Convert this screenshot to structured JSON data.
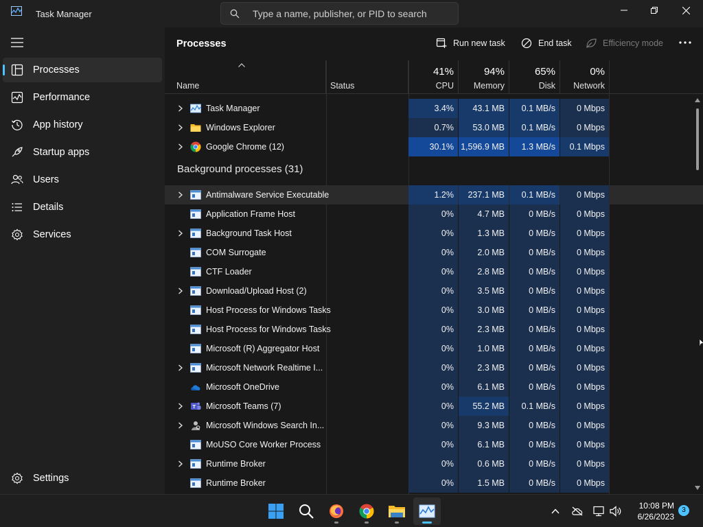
{
  "window": {
    "title": "Task Manager",
    "search_placeholder": "Type a name, publisher, or PID to search"
  },
  "sidebar": {
    "items": [
      {
        "label": "Processes",
        "icon": "processes-icon",
        "active": true
      },
      {
        "label": "Performance",
        "icon": "performance-icon"
      },
      {
        "label": "App history",
        "icon": "history-icon"
      },
      {
        "label": "Startup apps",
        "icon": "startup-icon"
      },
      {
        "label": "Users",
        "icon": "users-icon"
      },
      {
        "label": "Details",
        "icon": "details-icon"
      },
      {
        "label": "Services",
        "icon": "services-icon"
      }
    ],
    "settings_label": "Settings"
  },
  "toolbar": {
    "title": "Processes",
    "run_new_task": "Run new task",
    "end_task": "End task",
    "efficiency_mode": "Efficiency mode"
  },
  "columns": {
    "name": "Name",
    "status": "Status",
    "cpu": {
      "pct": "41%",
      "label": "CPU"
    },
    "memory": {
      "pct": "94%",
      "label": "Memory"
    },
    "disk": {
      "pct": "65%",
      "label": "Disk"
    },
    "network": {
      "pct": "0%",
      "label": "Network"
    }
  },
  "apps": [
    {
      "name": "Task Manager",
      "expandable": true,
      "icon": "taskmanager-icon",
      "cpu": "3.4%",
      "memory": "43.1 MB",
      "disk": "0.1 MB/s",
      "network": "0 Mbps",
      "heat": {
        "cpu": 2,
        "memory": 2,
        "disk": 2,
        "network": 1
      }
    },
    {
      "name": "Windows Explorer",
      "expandable": true,
      "icon": "folder-icon",
      "cpu": "0.7%",
      "memory": "53.0 MB",
      "disk": "0.1 MB/s",
      "network": "0 Mbps",
      "heat": {
        "cpu": 1,
        "memory": 2,
        "disk": 2,
        "network": 1
      }
    },
    {
      "name": "Google Chrome (12)",
      "expandable": true,
      "icon": "chrome-icon",
      "cpu": "30.1%",
      "memory": "1,596.9 MB",
      "disk": "1.3 MB/s",
      "network": "0.1 Mbps",
      "heat": {
        "cpu": 3,
        "memory": 3,
        "disk": 3,
        "network": 2
      }
    }
  ],
  "background": {
    "label": "Background processes (31)",
    "rows": [
      {
        "name": "Antimalware Service Executable",
        "expandable": true,
        "icon": "service-icon",
        "cpu": "1.2%",
        "memory": "237.1 MB",
        "disk": "0.1 MB/s",
        "network": "0 Mbps",
        "heat": {
          "cpu": 2,
          "memory": 2,
          "disk": 2,
          "network": 1
        },
        "hover": true
      },
      {
        "name": "Application Frame Host",
        "expandable": false,
        "icon": "service-icon",
        "cpu": "0%",
        "memory": "4.7 MB",
        "disk": "0 MB/s",
        "network": "0 Mbps",
        "heat": {
          "cpu": 1,
          "memory": 1,
          "disk": 1,
          "network": 1
        }
      },
      {
        "name": "Background Task Host",
        "expandable": true,
        "icon": "service-icon",
        "cpu": "0%",
        "memory": "1.3 MB",
        "disk": "0 MB/s",
        "network": "0 Mbps",
        "heat": {
          "cpu": 1,
          "memory": 1,
          "disk": 1,
          "network": 1
        }
      },
      {
        "name": "COM Surrogate",
        "expandable": false,
        "icon": "service-icon",
        "cpu": "0%",
        "memory": "2.0 MB",
        "disk": "0 MB/s",
        "network": "0 Mbps",
        "heat": {
          "cpu": 1,
          "memory": 1,
          "disk": 1,
          "network": 1
        }
      },
      {
        "name": "CTF Loader",
        "expandable": false,
        "icon": "service-icon",
        "cpu": "0%",
        "memory": "2.8 MB",
        "disk": "0 MB/s",
        "network": "0 Mbps",
        "heat": {
          "cpu": 1,
          "memory": 1,
          "disk": 1,
          "network": 1
        }
      },
      {
        "name": "Download/Upload Host (2)",
        "expandable": true,
        "icon": "service-icon",
        "cpu": "0%",
        "memory": "3.5 MB",
        "disk": "0 MB/s",
        "network": "0 Mbps",
        "heat": {
          "cpu": 1,
          "memory": 1,
          "disk": 1,
          "network": 1
        }
      },
      {
        "name": "Host Process for Windows Tasks",
        "expandable": false,
        "icon": "service-icon",
        "cpu": "0%",
        "memory": "3.0 MB",
        "disk": "0 MB/s",
        "network": "0 Mbps",
        "heat": {
          "cpu": 1,
          "memory": 1,
          "disk": 1,
          "network": 1
        }
      },
      {
        "name": "Host Process for Windows Tasks",
        "expandable": false,
        "icon": "service-icon",
        "cpu": "0%",
        "memory": "2.3 MB",
        "disk": "0 MB/s",
        "network": "0 Mbps",
        "heat": {
          "cpu": 1,
          "memory": 1,
          "disk": 1,
          "network": 1
        }
      },
      {
        "name": "Microsoft (R) Aggregator Host",
        "expandable": false,
        "icon": "service-icon",
        "cpu": "0%",
        "memory": "1.0 MB",
        "disk": "0 MB/s",
        "network": "0 Mbps",
        "heat": {
          "cpu": 1,
          "memory": 1,
          "disk": 1,
          "network": 1
        }
      },
      {
        "name": "Microsoft Network Realtime I...",
        "expandable": true,
        "icon": "service-icon",
        "cpu": "0%",
        "memory": "2.3 MB",
        "disk": "0 MB/s",
        "network": "0 Mbps",
        "heat": {
          "cpu": 1,
          "memory": 1,
          "disk": 1,
          "network": 1
        }
      },
      {
        "name": "Microsoft OneDrive",
        "expandable": false,
        "icon": "onedrive-icon",
        "cpu": "0%",
        "memory": "6.1 MB",
        "disk": "0 MB/s",
        "network": "0 Mbps",
        "heat": {
          "cpu": 1,
          "memory": 1,
          "disk": 1,
          "network": 1
        }
      },
      {
        "name": "Microsoft Teams (7)",
        "expandable": true,
        "icon": "teams-icon",
        "cpu": "0%",
        "memory": "55.2 MB",
        "disk": "0.1 MB/s",
        "network": "0 Mbps",
        "heat": {
          "cpu": 1,
          "memory": 2,
          "disk": 1,
          "network": 1
        }
      },
      {
        "name": "Microsoft Windows Search In...",
        "expandable": true,
        "icon": "search-indexer-icon",
        "cpu": "0%",
        "memory": "9.3 MB",
        "disk": "0 MB/s",
        "network": "0 Mbps",
        "heat": {
          "cpu": 1,
          "memory": 1,
          "disk": 1,
          "network": 1
        }
      },
      {
        "name": "MoUSO Core Worker Process",
        "expandable": false,
        "icon": "service-icon",
        "cpu": "0%",
        "memory": "6.1 MB",
        "disk": "0 MB/s",
        "network": "0 Mbps",
        "heat": {
          "cpu": 1,
          "memory": 1,
          "disk": 1,
          "network": 1
        }
      },
      {
        "name": "Runtime Broker",
        "expandable": true,
        "icon": "service-icon",
        "cpu": "0%",
        "memory": "0.6 MB",
        "disk": "0 MB/s",
        "network": "0 Mbps",
        "heat": {
          "cpu": 1,
          "memory": 1,
          "disk": 1,
          "network": 1
        }
      },
      {
        "name": "Runtime Broker",
        "expandable": false,
        "icon": "service-icon",
        "cpu": "0%",
        "memory": "1.5 MB",
        "disk": "0 MB/s",
        "network": "0 Mbps",
        "heat": {
          "cpu": 1,
          "memory": 1,
          "disk": 1,
          "network": 1
        }
      }
    ]
  },
  "taskbar": {
    "apps": [
      "start-icon",
      "search-icon",
      "firefox-icon",
      "chrome-icon",
      "file-explorer-icon",
      "taskmanager-icon"
    ],
    "time": "10:08 PM",
    "date": "6/26/2023",
    "notification_count": "3"
  },
  "colors": {
    "accent": "#4cc2ff",
    "heat_low": "#1b2f4f",
    "heat_mid": "#183a6b",
    "heat_high": "#14499a"
  }
}
